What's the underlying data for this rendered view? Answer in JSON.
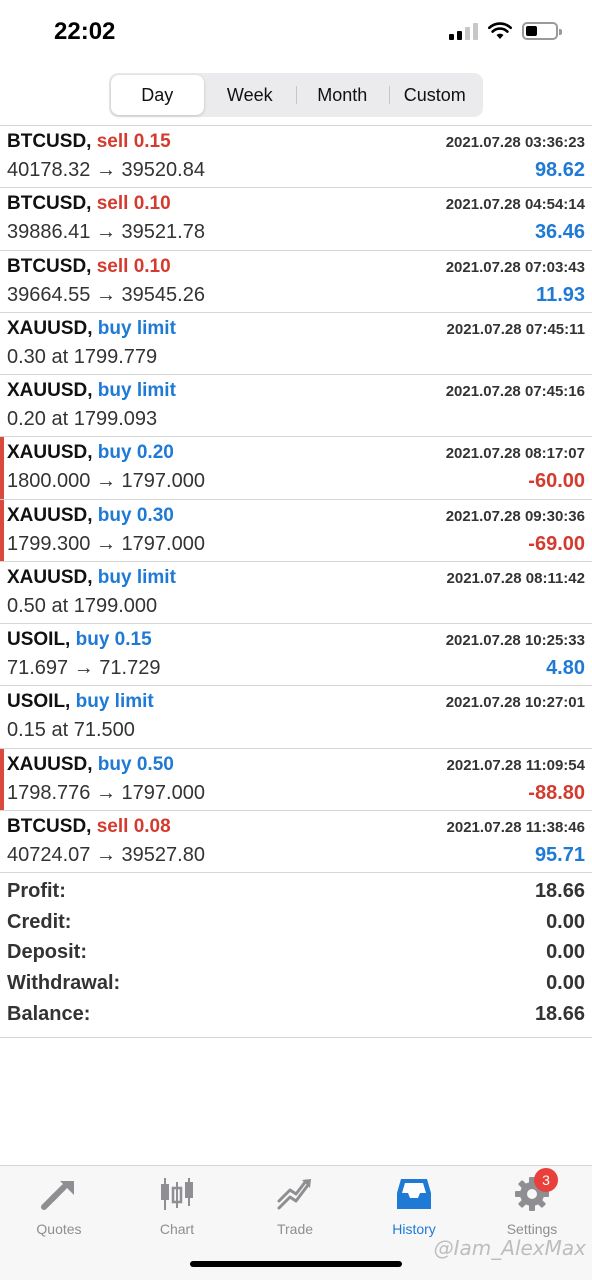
{
  "status": {
    "time": "22:02"
  },
  "segments": [
    {
      "label": "Day",
      "active": true
    },
    {
      "label": "Week",
      "active": false
    },
    {
      "label": "Month",
      "active": false
    },
    {
      "label": "Custom",
      "active": false
    }
  ],
  "orders": [
    {
      "symbol": "BTCUSD,",
      "action": "sell 0.15",
      "side": "sell",
      "time": "2021.07.28 03:36:23",
      "price": "40178.32 → 39520.84",
      "profit": "98.62",
      "sign": "pos"
    },
    {
      "symbol": "BTCUSD,",
      "action": "sell 0.10",
      "side": "sell",
      "time": "2021.07.28 04:54:14",
      "price": "39886.41 → 39521.78",
      "profit": "36.46",
      "sign": "pos"
    },
    {
      "symbol": "BTCUSD,",
      "action": "sell 0.10",
      "side": "sell",
      "time": "2021.07.28 07:03:43",
      "price": "39664.55 → 39545.26",
      "profit": "11.93",
      "sign": "pos"
    },
    {
      "symbol": "XAUUSD,",
      "action": "buy limit",
      "side": "buy",
      "time": "2021.07.28 07:45:11",
      "price": "0.30 at 1799.779",
      "profit": "",
      "sign": "none"
    },
    {
      "symbol": "XAUUSD,",
      "action": "buy limit",
      "side": "buy",
      "time": "2021.07.28 07:45:16",
      "price": "0.20 at 1799.093",
      "profit": "",
      "sign": "none"
    },
    {
      "symbol": "XAUUSD,",
      "action": "buy 0.20",
      "side": "buy",
      "time": "2021.07.28 08:17:07",
      "price": "1800.000 → 1797.000",
      "profit": "-60.00",
      "sign": "neg"
    },
    {
      "symbol": "XAUUSD,",
      "action": "buy 0.30",
      "side": "buy",
      "time": "2021.07.28 09:30:36",
      "price": "1799.300 → 1797.000",
      "profit": "-69.00",
      "sign": "neg"
    },
    {
      "symbol": "XAUUSD,",
      "action": "buy limit",
      "side": "buy",
      "time": "2021.07.28 08:11:42",
      "price": "0.50 at 1799.000",
      "profit": "",
      "sign": "none"
    },
    {
      "symbol": "USOIL,",
      "action": "buy 0.15",
      "side": "buy",
      "time": "2021.07.28 10:25:33",
      "price": "71.697 → 71.729",
      "profit": "4.80",
      "sign": "pos"
    },
    {
      "symbol": "USOIL,",
      "action": "buy limit",
      "side": "buy",
      "time": "2021.07.28 10:27:01",
      "price": "0.15 at 71.500",
      "profit": "",
      "sign": "none"
    },
    {
      "symbol": "XAUUSD,",
      "action": "buy 0.50",
      "side": "buy",
      "time": "2021.07.28 11:09:54",
      "price": "1798.776 → 1797.000",
      "profit": "-88.80",
      "sign": "neg"
    },
    {
      "symbol": "BTCUSD,",
      "action": "sell 0.08",
      "side": "sell",
      "time": "2021.07.28 11:38:46",
      "price": "40724.07 → 39527.80",
      "profit": "95.71",
      "sign": "pos"
    }
  ],
  "summary": [
    {
      "label": "Profit:",
      "value": "18.66"
    },
    {
      "label": "Credit:",
      "value": "0.00"
    },
    {
      "label": "Deposit:",
      "value": "0.00"
    },
    {
      "label": "Withdrawal:",
      "value": "0.00"
    },
    {
      "label": "Balance:",
      "value": "18.66"
    }
  ],
  "tabs": [
    {
      "label": "Quotes",
      "icon": "quotes-icon",
      "active": false
    },
    {
      "label": "Chart",
      "icon": "chart-icon",
      "active": false
    },
    {
      "label": "Trade",
      "icon": "trade-icon",
      "active": false
    },
    {
      "label": "History",
      "icon": "history-icon",
      "active": true
    },
    {
      "label": "Settings",
      "icon": "settings-icon",
      "active": false,
      "badge": "3"
    }
  ],
  "watermark": "@Iam_AlexMax",
  "colors": {
    "accent": "#1f7ad6",
    "loss": "#d43b2e",
    "inactive": "#8e8e93"
  }
}
